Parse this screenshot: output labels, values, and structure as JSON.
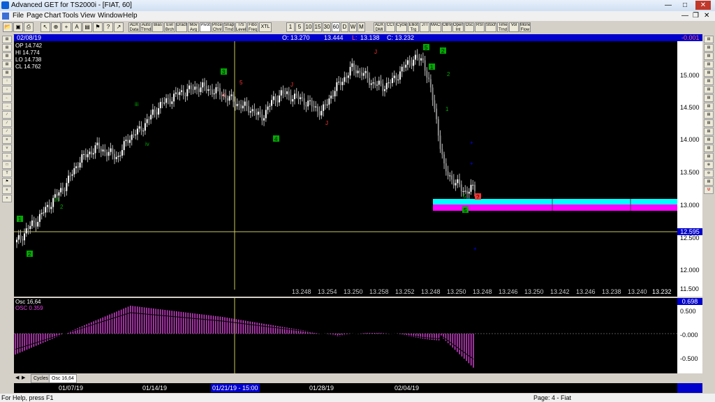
{
  "window": {
    "title": "Advanced GET for TS2000i - [FIAT, 60]"
  },
  "menu": [
    "File",
    "Page",
    "Chart",
    "Tools",
    "View",
    "Window",
    "Help"
  ],
  "toolbar": {
    "study_buttons": [
      "ADX Data",
      "Auto Ttrnd",
      "Bias",
      "Evil Brch",
      "Drach",
      "Mov Avg",
      "Pivot",
      "Price Chnl",
      "Snap Trnd",
      "T/S Level",
      "Fibo Freq",
      "XTL"
    ],
    "interval_buttons": [
      "1",
      "5",
      "10",
      "15",
      "30",
      "60",
      "D",
      "W",
      "M"
    ],
    "right_buttons": [
      "ADX DMI",
      "CCI",
      "Cycles",
      "Elliot Trg",
      "JTI",
      "MACD",
      "OBV",
      "Open Int",
      "Osc",
      "RSI",
      "Stoch",
      "Time Trnd",
      "Vol",
      "Money Flow"
    ]
  },
  "infobar": {
    "date": "02/08/19",
    "O": "O: 13.270",
    "H": "13.444",
    "L_label": "L:",
    "L": "13.138",
    "C": "C: 13.232",
    "change": "-0.001"
  },
  "ohlc_box": {
    "op": "OP  14.742",
    "hi": "HI   14.774",
    "lo": "LO  14.738",
    "cl": "CL  14.762"
  },
  "price_axis": {
    "labels": [
      "15.000",
      "14.500",
      "14.000",
      "13.500",
      "13.000",
      "12.500",
      "12.000",
      "11.500"
    ],
    "current": "12.595"
  },
  "bottom_values": [
    "13.248",
    "13.254",
    "13.250",
    "13.258",
    "13.252",
    "13.248",
    "13.250",
    "13.248",
    "13.246",
    "13.250",
    "13.242",
    "13.246",
    "13.238",
    "13.240",
    "13.232"
  ],
  "osc": {
    "title": "Osc 16,64",
    "value_label": "OSC 0.359",
    "current": "0.698",
    "labels": [
      "0.500",
      "-0.000",
      "-0.500"
    ]
  },
  "tabs": [
    "Cycles",
    "Osc 16,64"
  ],
  "dates": [
    "01/07/19",
    "01/14/19",
    "01/21/19 - 15:00",
    "01/28/19",
    "02/04/19"
  ],
  "status": {
    "left": "For Help, press F1",
    "right": "Page: 4 - Fiat"
  },
  "colors": {
    "accent": "#0000cc",
    "cyan_zone": "#00ffff",
    "magenta_zone": "#ff00ff",
    "osc": "#e040e0"
  },
  "chart_data": {
    "type": "candlestick",
    "ylim": [
      11.5,
      15.5
    ],
    "y_ticks": [
      15.0,
      14.5,
      14.0,
      13.5,
      13.0,
      12.5,
      12.0,
      11.5
    ],
    "close_path": [
      12.35,
      12.55,
      12.7,
      12.9,
      13.1,
      13.3,
      13.6,
      13.75,
      13.85,
      13.75,
      13.7,
      14.0,
      14.1,
      14.3,
      14.5,
      14.6,
      14.7,
      14.75,
      14.8,
      14.75,
      14.7,
      14.6,
      14.5,
      14.45,
      14.3,
      14.55,
      14.7,
      14.65,
      14.6,
      14.5,
      14.4,
      14.7,
      14.9,
      15.1,
      15.0,
      14.85,
      14.8,
      14.9,
      15.1,
      15.25,
      15.2,
      14.5,
      13.5,
      13.3,
      13.15,
      13.2
    ]
  }
}
